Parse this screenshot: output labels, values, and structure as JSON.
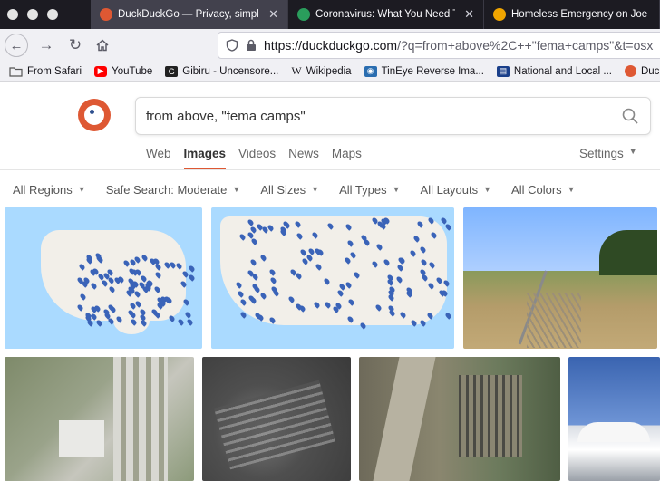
{
  "tabs": [
    {
      "title": "DuckDuckGo — Privacy, simplifi",
      "favicon_color": "#de5833",
      "active": true
    },
    {
      "title": "Coronavirus: What You Need To",
      "favicon_color": "#2a9d5c",
      "active": false
    },
    {
      "title": "Homeless Emergency on Joe Ro",
      "favicon_color": "#f0a500",
      "active": false
    }
  ],
  "nav": {
    "url_host": "https://duckduckgo.com",
    "url_rest": "/?q=from+above%2C++\"fema+camps\"&t=osx"
  },
  "bookmarks": [
    {
      "label": "From Safari",
      "icon": "folder-icon",
      "color": "#555555"
    },
    {
      "label": "YouTube",
      "icon": "youtube-icon",
      "color": "#ff0000"
    },
    {
      "label": "Gibiru - Uncensore...",
      "icon": "gibiru-icon",
      "color": "#222222"
    },
    {
      "label": "Wikipedia",
      "icon": "wikipedia-icon",
      "color": "#333333"
    },
    {
      "label": "TinEye Reverse Ima...",
      "icon": "tineye-icon",
      "color": "#2a6db0"
    },
    {
      "label": "National and Local ...",
      "icon": "news-icon",
      "color": "#1a3f8a"
    },
    {
      "label": "DuckD",
      "icon": "duckduckgo-icon",
      "color": "#de5833"
    }
  ],
  "search": {
    "query": "from above, \"fema camps\""
  },
  "verticals": [
    "Web",
    "Images",
    "Videos",
    "News",
    "Maps"
  ],
  "active_vertical": "Images",
  "settings_label": "Settings",
  "filters": [
    "All Regions",
    "Safe Search: Moderate",
    "All Sizes",
    "All Types",
    "All Layouts",
    "All Colors"
  ],
  "colors": {
    "accent": "#de5833"
  }
}
